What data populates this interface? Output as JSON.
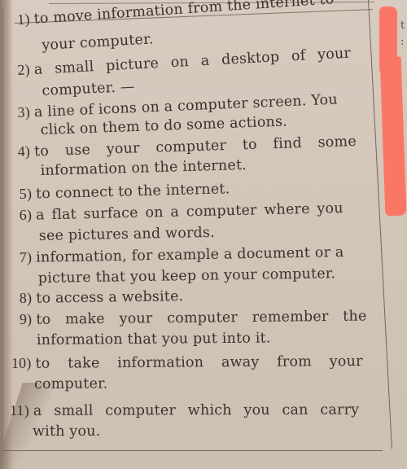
{
  "page": {
    "type": "textbook-exercise",
    "accent_colors": {
      "highlighter": "#fb7765",
      "ink": "#3a332d",
      "paper": "#d3c5b7"
    }
  },
  "items": [
    {
      "number": "1)",
      "lines": [
        "to move information from the internet to",
        "your computer."
      ]
    },
    {
      "number": "2)",
      "lines": [
        "a small picture on a desktop of your",
        "computer. —"
      ]
    },
    {
      "number": "3)",
      "lines": [
        "a line of icons on a computer screen. You",
        "click on them to do some actions."
      ]
    },
    {
      "number": "4)",
      "lines": [
        "to use your computer to find some",
        "information on the internet."
      ]
    },
    {
      "number": "5)",
      "lines": [
        "to connect to the internet."
      ]
    },
    {
      "number": "6)",
      "lines": [
        "a flat surface on a computer where you",
        "see pictures and words."
      ]
    },
    {
      "number": "7)",
      "lines": [
        "information, for example a document or a",
        "picture that you keep on your computer."
      ]
    },
    {
      "number": "8)",
      "lines": [
        "to access a website."
      ]
    },
    {
      "number": "9)",
      "lines": [
        "to make your computer remember the",
        "information that you put into it."
      ]
    },
    {
      "number": "10)",
      "lines": [
        "to take information away from your",
        "computer."
      ]
    },
    {
      "number": "11)",
      "lines": [
        "a small computer which you can carry",
        "with you."
      ]
    }
  ],
  "edge_fragments": [
    "t",
    ":"
  ]
}
